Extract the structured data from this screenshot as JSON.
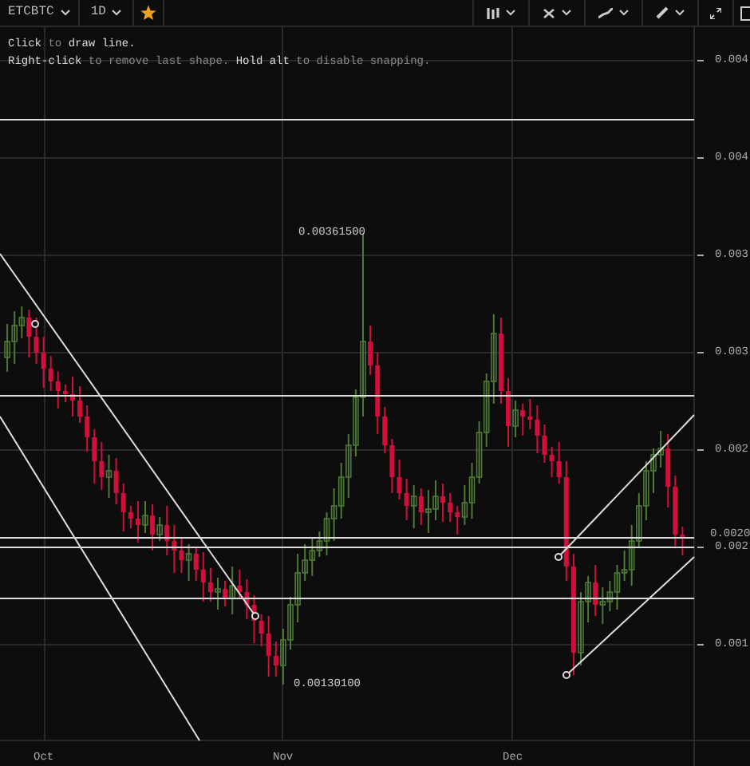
{
  "toolbar": {
    "symbol": "ETCBTC",
    "interval": "1D",
    "starred": true
  },
  "hints": [
    "**Click** to **draw line.**",
    "**Right-click** to remove last shape. **Hold alt** to disable snapping."
  ],
  "chart": {
    "price_labels": [
      {
        "text": "0.00361500",
        "kind": "high"
      },
      {
        "text": "0.00130100",
        "kind": "low"
      }
    ],
    "y_ticks": [
      "0.004",
      "0.004",
      "0.003",
      "0.003",
      "0.002",
      "0.002",
      "0.001"
    ],
    "last_price": "0.0020",
    "x_ticks": [
      "Oct",
      "Nov",
      "Dec"
    ]
  }
}
